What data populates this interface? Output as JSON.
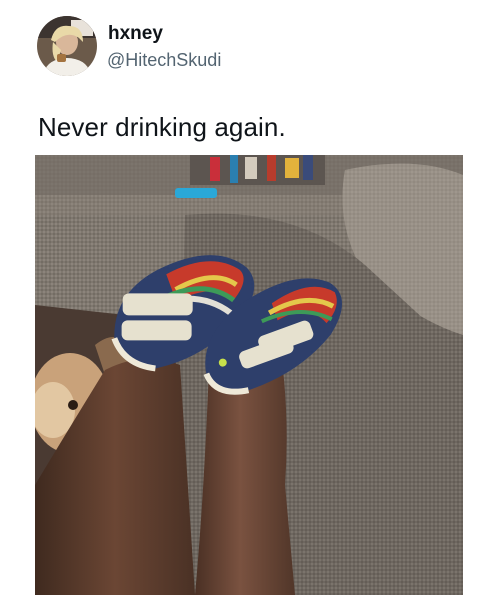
{
  "tweet": {
    "author": {
      "display_name": "hxney",
      "handle": "@HitechSkudi",
      "avatar_icon": "user-avatar-photo"
    },
    "text": "Never drinking again.",
    "media": {
      "kind": "photo",
      "icon": "photo-legs-bowling-shoes-on-couch"
    }
  },
  "colors": {
    "text_primary": "#0f1419",
    "text_secondary": "#536471",
    "background": "#ffffff"
  }
}
